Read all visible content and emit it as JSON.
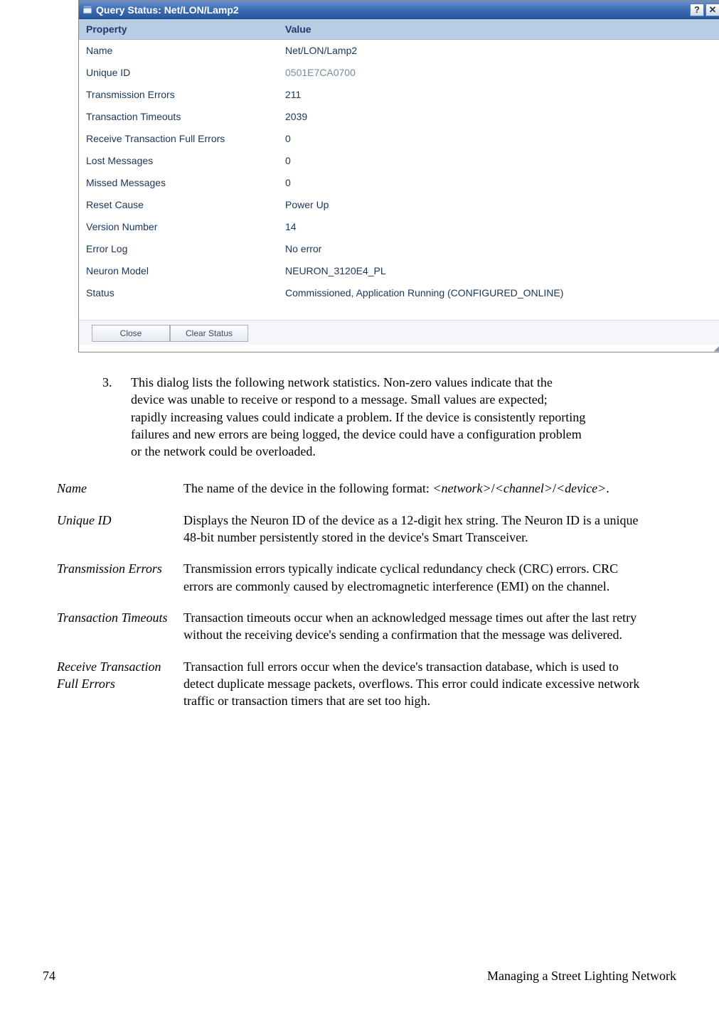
{
  "dialog": {
    "title": "Query Status: Net/LON/Lamp2",
    "help_btn": "?",
    "close_x": "✕",
    "header_property": "Property",
    "header_value": "Value",
    "rows": [
      {
        "prop": "Name",
        "val": "Net/LON/Lamp2",
        "dim": false
      },
      {
        "prop": "Unique ID",
        "val": "0501E7CA0700",
        "dim": true
      },
      {
        "prop": "Transmission Errors",
        "val": "211",
        "dim": false
      },
      {
        "prop": "Transaction Timeouts",
        "val": "2039",
        "dim": false
      },
      {
        "prop": "Receive Transaction Full Errors",
        "val": "0",
        "dim": false
      },
      {
        "prop": "Lost Messages",
        "val": "0",
        "dim": false
      },
      {
        "prop": "Missed Messages",
        "val": "0",
        "dim": false
      },
      {
        "prop": "Reset Cause",
        "val": "Power Up",
        "dim": false
      },
      {
        "prop": "Version Number",
        "val": "14",
        "dim": false
      },
      {
        "prop": "Error Log",
        "val": "No error",
        "dim": false
      },
      {
        "prop": "Neuron Model",
        "val": "NEURON_3120E4_PL",
        "dim": false
      },
      {
        "prop": "Status",
        "val": "Commissioned, Application Running (CONFIGURED_ONLINE)",
        "dim": false
      }
    ],
    "buttons": {
      "close": "Close",
      "clear_status": "Clear Status"
    }
  },
  "step": {
    "num": "3.",
    "text": "This dialog lists the following network statistics.  Non-zero values indicate that the device was unable to receive or respond to a message.  Small values are expected; rapidly increasing values could indicate a problem.  If the device is consistently reporting failures and new errors are being logged, the device could have a configuration problem or the network could be overloaded."
  },
  "definitions": [
    {
      "term": "Name",
      "desc_pre": "The name of the device in the following format: ",
      "fmt_network": "<network>",
      "sep1": "/",
      "fmt_channel": "<channel>",
      "sep2": "/",
      "fmt_device": "<device>",
      "desc_post": "."
    },
    {
      "term": "Unique ID",
      "desc": "Displays the Neuron ID of the device as a 12-digit hex string.  The Neuron ID is a unique 48-bit number persistently stored in the device's Smart Transceiver."
    },
    {
      "term": "Transmission Errors",
      "desc": "Transmission errors typically indicate cyclical redundancy check (CRC) errors.  CRC errors are commonly caused by electromagnetic interference (EMI) on the channel."
    },
    {
      "term": "Transaction Timeouts",
      "desc": "Transaction timeouts occur when an acknowledged message times out after the last retry without the receiving device's sending a confirmation that the message was delivered."
    },
    {
      "term": "Receive Transaction Full Errors",
      "desc": "Transaction full errors occur when the device's transaction database, which is used to detect duplicate message packets, overflows.  This error could indicate excessive network traffic or transaction timers that are set too high."
    }
  ],
  "footer": {
    "page": "74",
    "section": "Managing a Street Lighting Network"
  }
}
